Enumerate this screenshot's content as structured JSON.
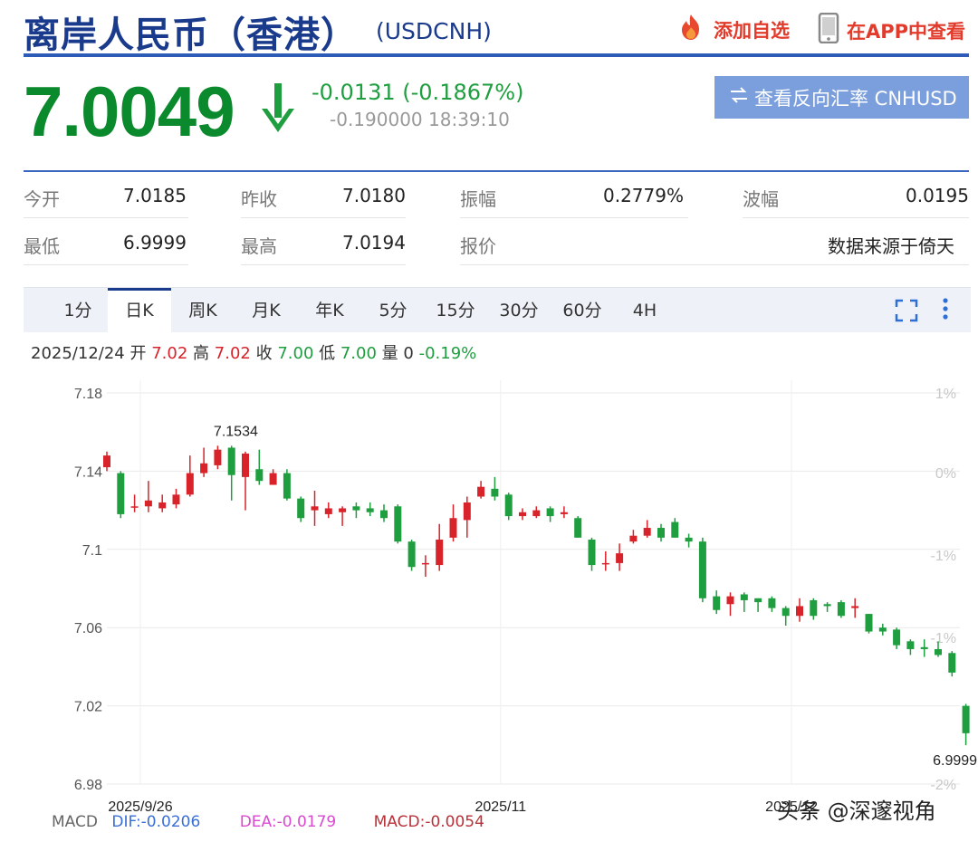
{
  "header": {
    "title": "离岸人民币（香港）",
    "symbol": "(USDCNH)",
    "add_watchlist": "添加自选",
    "view_in_app": "在APP中查看"
  },
  "quote": {
    "price": "7.0049",
    "change": "-0.0131 (-0.1867%)",
    "subline": "-0.190000 18:39:10",
    "reverse_button": "查看反向汇率 CNHUSD"
  },
  "stats": {
    "open_label": "今开",
    "open": "7.0185",
    "prev_close_label": "昨收",
    "prev_close": "7.0180",
    "amplitude_label": "振幅",
    "amplitude": "0.2779%",
    "wave_label": "波幅",
    "wave": "0.0195",
    "low_label": "最低",
    "low": "6.9999",
    "high_label": "最高",
    "high": "7.0194",
    "quote_label": "报价",
    "source": "数据来源于倚天"
  },
  "tabs": [
    "1分",
    "日K",
    "周K",
    "月K",
    "年K",
    "5分",
    "15分",
    "30分",
    "60分",
    "4H"
  ],
  "active_tab": "日K",
  "ohlc": {
    "date": "2025/12/24",
    "open_label": "开",
    "open": "7.02",
    "high_label": "高",
    "high": "7.02",
    "close_label": "收",
    "close": "7.00",
    "low_label": "低",
    "low": "7.00",
    "volume_label": "量",
    "volume": "0",
    "change": "-0.19%"
  },
  "colors": {
    "up": "#d8232a",
    "down": "#1e9e3e",
    "brand": "#1a3a8c"
  },
  "chart_data": {
    "type": "candlestick",
    "y_ticks": [
      "7.18",
      "7.14",
      "7.1",
      "7.06",
      "7.02",
      "6.98"
    ],
    "ylim": [
      6.98,
      7.18
    ],
    "pct_ticks": [
      "1%",
      "0%",
      "-1%",
      "-1%",
      "-2%"
    ],
    "x_labels": [
      {
        "label": "2025/9/26",
        "index": 0
      },
      {
        "label": "2025/11",
        "index": 26
      },
      {
        "label": "2025/12",
        "index": 47
      }
    ],
    "annotations": [
      {
        "label": "7.1534",
        "index": 8,
        "value": 7.1534
      },
      {
        "label": "6.9999",
        "index": 62,
        "value": 6.9999
      }
    ],
    "grid": true,
    "candles": [
      [
        7.142,
        7.148,
        7.15,
        7.14
      ],
      [
        7.139,
        7.118,
        7.14,
        7.116
      ],
      [
        7.122,
        7.122,
        7.128,
        7.119
      ],
      [
        7.122,
        7.125,
        7.135,
        7.119
      ],
      [
        7.121,
        7.124,
        7.128,
        7.119
      ],
      [
        7.123,
        7.128,
        7.131,
        7.121
      ],
      [
        7.128,
        7.139,
        7.148,
        7.127
      ],
      [
        7.139,
        7.144,
        7.152,
        7.137
      ],
      [
        7.143,
        7.151,
        7.153,
        7.141
      ],
      [
        7.152,
        7.138,
        7.153,
        7.125
      ],
      [
        7.137,
        7.149,
        7.15,
        7.12
      ],
      [
        7.141,
        7.135,
        7.151,
        7.133
      ],
      [
        7.133,
        7.139,
        7.141,
        7.133
      ],
      [
        7.139,
        7.126,
        7.141,
        7.125
      ],
      [
        7.126,
        7.116,
        7.127,
        7.114
      ],
      [
        7.12,
        7.122,
        7.13,
        7.112
      ],
      [
        7.118,
        7.121,
        7.124,
        7.116
      ],
      [
        7.119,
        7.121,
        7.122,
        7.112
      ],
      [
        7.122,
        7.12,
        7.124,
        7.116
      ],
      [
        7.121,
        7.119,
        7.124,
        7.117
      ],
      [
        7.12,
        7.116,
        7.123,
        7.114
      ],
      [
        7.122,
        7.104,
        7.123,
        7.103
      ],
      [
        7.104,
        7.091,
        7.105,
        7.089
      ],
      [
        7.093,
        7.093,
        7.097,
        7.086
      ],
      [
        7.092,
        7.105,
        7.113,
        7.089
      ],
      [
        7.106,
        7.116,
        7.123,
        7.104
      ],
      [
        7.115,
        7.124,
        7.127,
        7.106
      ],
      [
        7.127,
        7.132,
        7.135,
        7.126
      ],
      [
        7.131,
        7.127,
        7.137,
        7.125
      ],
      [
        7.128,
        7.117,
        7.129,
        7.115
      ],
      [
        7.117,
        7.119,
        7.121,
        7.115
      ],
      [
        7.117,
        7.12,
        7.122,
        7.116
      ],
      [
        7.121,
        7.117,
        7.122,
        7.114
      ],
      [
        7.118,
        7.119,
        7.122,
        7.116
      ],
      [
        7.116,
        7.106,
        7.117,
        7.106
      ],
      [
        7.105,
        7.092,
        7.106,
        7.089
      ],
      [
        7.093,
        7.093,
        7.099,
        7.089
      ],
      [
        7.093,
        7.098,
        7.103,
        7.089
      ],
      [
        7.104,
        7.107,
        7.11,
        7.103
      ],
      [
        7.107,
        7.111,
        7.115,
        7.106
      ],
      [
        7.111,
        7.106,
        7.113,
        7.104
      ],
      [
        7.114,
        7.106,
        7.116,
        7.106
      ],
      [
        7.106,
        7.104,
        7.108,
        7.101
      ],
      [
        7.104,
        7.075,
        7.106,
        7.073
      ],
      [
        7.076,
        7.069,
        7.079,
        7.067
      ],
      [
        7.072,
        7.076,
        7.078,
        7.066
      ],
      [
        7.077,
        7.074,
        7.078,
        7.068
      ],
      [
        7.075,
        7.073,
        7.075,
        7.068
      ],
      [
        7.075,
        7.07,
        7.076,
        7.068
      ],
      [
        7.07,
        7.066,
        7.071,
        7.061
      ],
      [
        7.066,
        7.071,
        7.075,
        7.063
      ],
      [
        7.074,
        7.066,
        7.075,
        7.064
      ],
      [
        7.072,
        7.071,
        7.073,
        7.068
      ],
      [
        7.073,
        7.066,
        7.074,
        7.065
      ],
      [
        7.07,
        7.071,
        7.075,
        7.065
      ],
      [
        7.067,
        7.058,
        7.067,
        7.057
      ],
      [
        7.06,
        7.058,
        7.062,
        7.056
      ],
      [
        7.059,
        7.051,
        7.06,
        7.049
      ],
      [
        7.053,
        7.049,
        7.054,
        7.046
      ],
      [
        7.05,
        7.049,
        7.054,
        7.045
      ],
      [
        7.049,
        7.046,
        7.053,
        7.045
      ],
      [
        7.047,
        7.037,
        7.048,
        7.035
      ],
      [
        7.02,
        7.006,
        7.021,
        6.9999
      ]
    ]
  },
  "macd": {
    "label": "MACD",
    "dif_label": "DIF:",
    "dif": "-0.0206",
    "dea_label": "DEA:",
    "dea": "-0.0179",
    "macd_label": "MACD:",
    "macd": "-0.0054"
  },
  "watermark": "头条 @深邃视角"
}
